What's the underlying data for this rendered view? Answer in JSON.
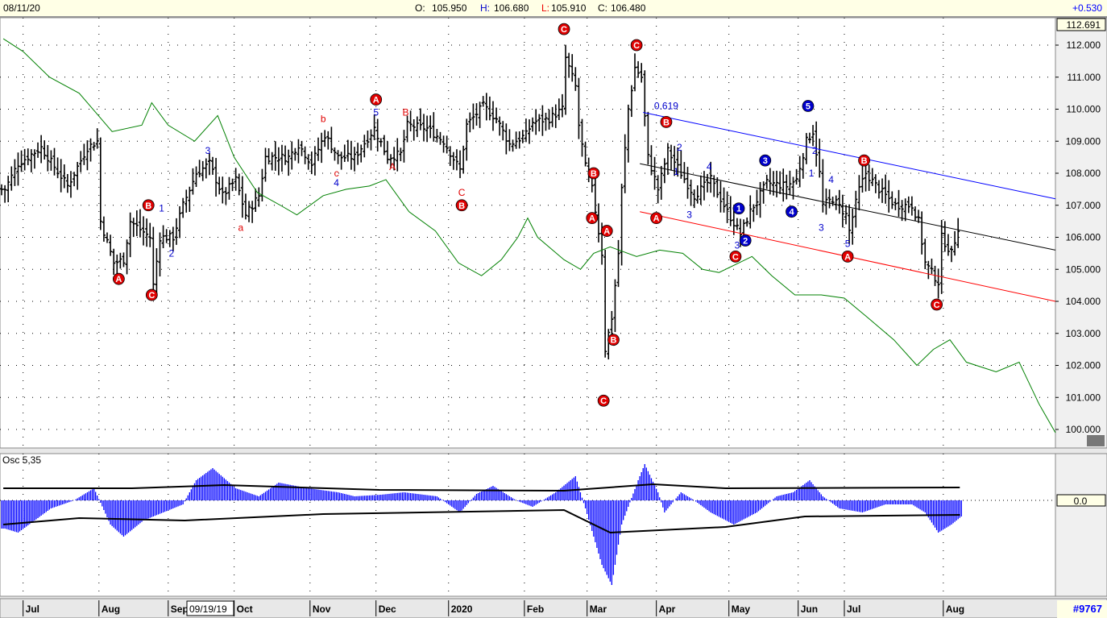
{
  "header": {
    "date": "08/11/20",
    "o_label": "O:",
    "o": "105.950",
    "h_label": "H:",
    "h": "106.680",
    "l_label": "L:",
    "l": "105.910",
    "c_label": "C:",
    "c": "106.480",
    "change": "+0.530"
  },
  "footer": {
    "cursor_date": "09/19/19",
    "id": "#9767"
  },
  "osc": {
    "title": "Osc 5,35",
    "zero_label": "0.0"
  },
  "colors": {
    "bars": "#000000",
    "ma": "#008000",
    "channel_upper": "#0000ff",
    "channel_mid": "#000000",
    "channel_lower": "#ff0000",
    "histogram": "#0000ff",
    "wave_red": "#e00000",
    "wave_blue": "#0000cc"
  },
  "chart_data": {
    "type": "ohlc",
    "x_unit": "trading day index",
    "xlim": [
      0,
      320
    ],
    "ylim": [
      99.6,
      112.691
    ],
    "last_price_label": "112.691",
    "y_ticks": [
      "112.000",
      "111.000",
      "110.000",
      "109.000",
      "108.000",
      "107.000",
      "106.000",
      "105.000",
      "104.000",
      "103.000",
      "102.000",
      "101.000",
      "100.000"
    ],
    "x_ticks": [
      {
        "label": "Jul",
        "x": 7
      },
      {
        "label": "Aug",
        "x": 30
      },
      {
        "label": "Sep",
        "x": 51
      },
      {
        "label": "Oct",
        "x": 71
      },
      {
        "label": "Nov",
        "x": 94
      },
      {
        "label": "Dec",
        "x": 114
      },
      {
        "label": "2020",
        "x": 136
      },
      {
        "label": "Feb",
        "x": 159
      },
      {
        "label": "Mar",
        "x": 178
      },
      {
        "label": "Apr",
        "x": 199
      },
      {
        "label": "May",
        "x": 221
      },
      {
        "label": "Jun",
        "x": 242
      },
      {
        "label": "Jul",
        "x": 256
      },
      {
        "label": "Aug",
        "x": 286
      }
    ],
    "price_path": [
      [
        1,
        107.5
      ],
      [
        5,
        108.3
      ],
      [
        12,
        108.8
      ],
      [
        20,
        107.6
      ],
      [
        26,
        108.8
      ],
      [
        29,
        109
      ],
      [
        30,
        106.5
      ],
      [
        34,
        105.2
      ],
      [
        37,
        105.3
      ],
      [
        39,
        106.5
      ],
      [
        45,
        106
      ],
      [
        46,
        104.5
      ],
      [
        48,
        106
      ],
      [
        52,
        106
      ],
      [
        55,
        107
      ],
      [
        59,
        108
      ],
      [
        63,
        108.3
      ],
      [
        67,
        107.3
      ],
      [
        71,
        107.8
      ],
      [
        74,
        106.7
      ],
      [
        78,
        107.3
      ],
      [
        80,
        108.5
      ],
      [
        87,
        108.5
      ],
      [
        90,
        108.9
      ],
      [
        94,
        108.3
      ],
      [
        98,
        109.2
      ],
      [
        102,
        108.5
      ],
      [
        107,
        108.5
      ],
      [
        113,
        109.4
      ],
      [
        117,
        108.5
      ],
      [
        121,
        108.6
      ],
      [
        123,
        109.5
      ],
      [
        129,
        109.4
      ],
      [
        134,
        109
      ],
      [
        139,
        108.1
      ],
      [
        141,
        109.5
      ],
      [
        146,
        110.1
      ],
      [
        150,
        109.7
      ],
      [
        154,
        108.9
      ],
      [
        159,
        109.2
      ],
      [
        161,
        109.6
      ],
      [
        166,
        109.7
      ],
      [
        170,
        110
      ],
      [
        171,
        111.6
      ],
      [
        174,
        110.7
      ],
      [
        175,
        109.5
      ],
      [
        177,
        108.2
      ],
      [
        179,
        107.5
      ],
      [
        182,
        105.5
      ],
      [
        183,
        102.5
      ],
      [
        185,
        103.5
      ],
      [
        187,
        105.5
      ],
      [
        188,
        107.5
      ],
      [
        190,
        110
      ],
      [
        192,
        111.3
      ],
      [
        194,
        111
      ],
      [
        196,
        108.5
      ],
      [
        199,
        107.5
      ],
      [
        202,
        108.7
      ],
      [
        206,
        108
      ],
      [
        210,
        107.3
      ],
      [
        215,
        107.8
      ],
      [
        220,
        106.8
      ],
      [
        224,
        106.1
      ],
      [
        227,
        106.8
      ],
      [
        232,
        107.7
      ],
      [
        238,
        107.6
      ],
      [
        241,
        107.8
      ],
      [
        244,
        109
      ],
      [
        246,
        109.3
      ],
      [
        248,
        108
      ],
      [
        249,
        107
      ],
      [
        252,
        107.2
      ],
      [
        256,
        106.7
      ],
      [
        257,
        106.2
      ],
      [
        260,
        107.5
      ],
      [
        262,
        108
      ],
      [
        266,
        107.5
      ],
      [
        271,
        107
      ],
      [
        276,
        107
      ],
      [
        278,
        106.5
      ],
      [
        280,
        105.2
      ],
      [
        284,
        104.6
      ],
      [
        285,
        106
      ],
      [
        288,
        105.5
      ],
      [
        290,
        106.3
      ]
    ],
    "ma_line": [
      [
        1,
        112.2
      ],
      [
        7,
        111.8
      ],
      [
        15,
        111
      ],
      [
        24,
        110.5
      ],
      [
        34,
        109.3
      ],
      [
        43,
        109.5
      ],
      [
        46,
        110.2
      ],
      [
        51,
        109.5
      ],
      [
        59,
        109
      ],
      [
        66,
        109.8
      ],
      [
        71,
        108.5
      ],
      [
        78,
        107.4
      ],
      [
        85,
        107
      ],
      [
        90,
        106.7
      ],
      [
        98,
        107.3
      ],
      [
        105,
        107.5
      ],
      [
        112,
        107.6
      ],
      [
        117,
        107.8
      ],
      [
        124,
        106.8
      ],
      [
        132,
        106.2
      ],
      [
        139,
        105.2
      ],
      [
        146,
        104.8
      ],
      [
        152,
        105.3
      ],
      [
        157,
        106
      ],
      [
        160,
        106.6
      ],
      [
        163,
        106
      ],
      [
        171,
        105.3
      ],
      [
        176,
        105
      ],
      [
        180,
        105.5
      ],
      [
        185,
        105.7
      ],
      [
        193,
        105.4
      ],
      [
        200,
        105.6
      ],
      [
        207,
        105.5
      ],
      [
        213,
        105
      ],
      [
        218,
        104.9
      ],
      [
        224,
        105.2
      ],
      [
        228,
        105.4
      ],
      [
        234,
        104.8
      ],
      [
        241,
        104.2
      ],
      [
        249,
        104.2
      ],
      [
        256,
        104.1
      ],
      [
        263,
        103.5
      ],
      [
        271,
        102.8
      ],
      [
        278,
        102
      ],
      [
        283,
        102.5
      ],
      [
        288,
        102.8
      ],
      [
        293,
        102.1
      ],
      [
        302,
        101.8
      ],
      [
        309,
        102.1
      ],
      [
        315,
        100.8
      ],
      [
        320,
        99.9
      ]
    ],
    "channels": [
      {
        "name": "upper",
        "color": "#0000ff",
        "from": [
          195,
          109.9
        ],
        "to": [
          320,
          107.2
        ]
      },
      {
        "name": "mid",
        "color": "#000000",
        "from": [
          194,
          108.3
        ],
        "to": [
          320,
          105.6
        ]
      },
      {
        "name": "lower",
        "color": "#ff0000",
        "from": [
          194,
          106.8
        ],
        "to": [
          320,
          104.0
        ]
      }
    ],
    "wave_circles": [
      {
        "x": 171,
        "y": 112.5,
        "label": "C",
        "color": "red"
      },
      {
        "x": 193,
        "y": 112.0,
        "label": "C",
        "color": "red"
      },
      {
        "x": 36,
        "y": 104.7,
        "label": "A",
        "color": "red"
      },
      {
        "x": 46,
        "y": 104.2,
        "label": "C",
        "color": "red"
      },
      {
        "x": 45,
        "y": 107.0,
        "label": "B",
        "color": "red"
      },
      {
        "x": 114,
        "y": 110.3,
        "label": "A",
        "color": "red"
      },
      {
        "x": 140,
        "y": 107.0,
        "label": "B",
        "color": "red"
      },
      {
        "x": 180,
        "y": 108.0,
        "label": "B",
        "color": "red"
      },
      {
        "x": 179.5,
        "y": 106.6,
        "label": "A",
        "color": "red"
      },
      {
        "x": 184,
        "y": 106.2,
        "label": "A",
        "color": "red"
      },
      {
        "x": 186,
        "y": 102.8,
        "label": "B",
        "color": "red"
      },
      {
        "x": 183,
        "y": 100.9,
        "label": "C",
        "color": "red"
      },
      {
        "x": 202,
        "y": 109.6,
        "label": "B",
        "color": "red"
      },
      {
        "x": 199,
        "y": 106.6,
        "label": "A",
        "color": "red"
      },
      {
        "x": 223,
        "y": 105.4,
        "label": "C",
        "color": "red"
      },
      {
        "x": 257,
        "y": 105.4,
        "label": "A",
        "color": "red"
      },
      {
        "x": 262,
        "y": 108.4,
        "label": "B",
        "color": "red"
      },
      {
        "x": 284,
        "y": 103.9,
        "label": "C",
        "color": "red"
      },
      {
        "x": 224,
        "y": 106.9,
        "label": "1",
        "color": "blue"
      },
      {
        "x": 226,
        "y": 105.9,
        "label": "2",
        "color": "blue"
      },
      {
        "x": 232,
        "y": 108.4,
        "label": "3",
        "color": "blue"
      },
      {
        "x": 240,
        "y": 106.8,
        "label": "4",
        "color": "blue"
      },
      {
        "x": 245,
        "y": 110.1,
        "label": "5",
        "color": "blue"
      }
    ],
    "wave_texts": [
      {
        "x": 63,
        "y": 108.7,
        "label": "3",
        "color": "blue"
      },
      {
        "x": 49,
        "y": 106.9,
        "label": "1",
        "color": "blue"
      },
      {
        "x": 52,
        "y": 105.5,
        "label": "2",
        "color": "blue"
      },
      {
        "x": 102,
        "y": 107.7,
        "label": "4",
        "color": "blue"
      },
      {
        "x": 114,
        "y": 109.9,
        "label": "5",
        "color": "blue"
      },
      {
        "x": 206,
        "y": 108.8,
        "label": "2",
        "color": "blue"
      },
      {
        "x": 205,
        "y": 108.05,
        "label": "1",
        "color": "blue"
      },
      {
        "x": 209,
        "y": 106.7,
        "label": "3",
        "color": "blue"
      },
      {
        "x": 215,
        "y": 108.2,
        "label": "4",
        "color": "blue"
      },
      {
        "x": 223.5,
        "y": 105.75,
        "label": "3",
        "color": "blue"
      },
      {
        "x": 246,
        "y": 108.0,
        "label": "1",
        "color": "blue"
      },
      {
        "x": 247,
        "y": 108.7,
        "label": "2",
        "color": "blue"
      },
      {
        "x": 249,
        "y": 106.3,
        "label": "3",
        "color": "blue"
      },
      {
        "x": 252,
        "y": 107.8,
        "label": "4",
        "color": "blue"
      },
      {
        "x": 257,
        "y": 105.8,
        "label": "5",
        "color": "blue"
      },
      {
        "x": 202,
        "y": 110.1,
        "label": "0.619",
        "color": "blue"
      },
      {
        "x": 73,
        "y": 106.3,
        "label": "a",
        "color": "red"
      },
      {
        "x": 98,
        "y": 109.7,
        "label": "b",
        "color": "red"
      },
      {
        "x": 102,
        "y": 108.0,
        "label": "c",
        "color": "red"
      },
      {
        "x": 119,
        "y": 108.2,
        "label": "A",
        "color": "red"
      },
      {
        "x": 123,
        "y": 109.9,
        "label": "B",
        "color": "red"
      },
      {
        "x": 140,
        "y": 107.4,
        "label": "C",
        "color": "red"
      }
    ],
    "oscillator": {
      "name": "Osc 5,35",
      "histogram": [
        [
          1,
          -0.35
        ],
        [
          5,
          -0.4
        ],
        [
          15,
          -0.1
        ],
        [
          22,
          0
        ],
        [
          28,
          0.15
        ],
        [
          33,
          -0.3
        ],
        [
          37,
          -0.45
        ],
        [
          43,
          -0.25
        ],
        [
          49,
          -0.15
        ],
        [
          55,
          -0.05
        ],
        [
          59,
          0.25
        ],
        [
          64,
          0.4
        ],
        [
          71,
          0.15
        ],
        [
          78,
          0.05
        ],
        [
          84,
          0.22
        ],
        [
          93,
          0.15
        ],
        [
          102,
          0.1
        ],
        [
          107,
          0.05
        ],
        [
          115,
          0.07
        ],
        [
          122,
          0.1
        ],
        [
          132,
          0.05
        ],
        [
          139,
          -0.15
        ],
        [
          144,
          0.08
        ],
        [
          149,
          0.18
        ],
        [
          156,
          0
        ],
        [
          161,
          -0.08
        ],
        [
          168,
          0.1
        ],
        [
          174,
          0.3
        ],
        [
          177,
          -0.1
        ],
        [
          182,
          -0.8
        ],
        [
          185,
          -1.05
        ],
        [
          188,
          -0.3
        ],
        [
          193,
          0.25
        ],
        [
          195,
          0.45
        ],
        [
          199,
          0.1
        ],
        [
          201,
          -0.15
        ],
        [
          206,
          0.1
        ],
        [
          210,
          0
        ],
        [
          215,
          -0.15
        ],
        [
          222,
          -0.3
        ],
        [
          229,
          -0.15
        ],
        [
          235,
          0.05
        ],
        [
          240,
          0.1
        ],
        [
          245,
          0.25
        ],
        [
          249,
          0.05
        ],
        [
          254,
          -0.1
        ],
        [
          261,
          -0.15
        ],
        [
          268,
          -0.05
        ],
        [
          276,
          -0.05
        ],
        [
          280,
          -0.15
        ],
        [
          284,
          -0.4
        ],
        [
          288,
          -0.3
        ],
        [
          291,
          -0.2
        ]
      ],
      "upper_band": [
        [
          1,
          0.15
        ],
        [
          40,
          0.15
        ],
        [
          68,
          0.19
        ],
        [
          115,
          0.13
        ],
        [
          171,
          0.12
        ],
        [
          198,
          0.2
        ],
        [
          220,
          0.15
        ],
        [
          291,
          0.16
        ]
      ],
      "lower_band": [
        [
          1,
          -0.3
        ],
        [
          24,
          -0.22
        ],
        [
          56,
          -0.25
        ],
        [
          98,
          -0.17
        ],
        [
          171,
          -0.12
        ],
        [
          185,
          -0.4
        ],
        [
          195,
          -0.38
        ],
        [
          220,
          -0.33
        ],
        [
          244,
          -0.2
        ],
        [
          291,
          -0.18
        ]
      ]
    }
  }
}
